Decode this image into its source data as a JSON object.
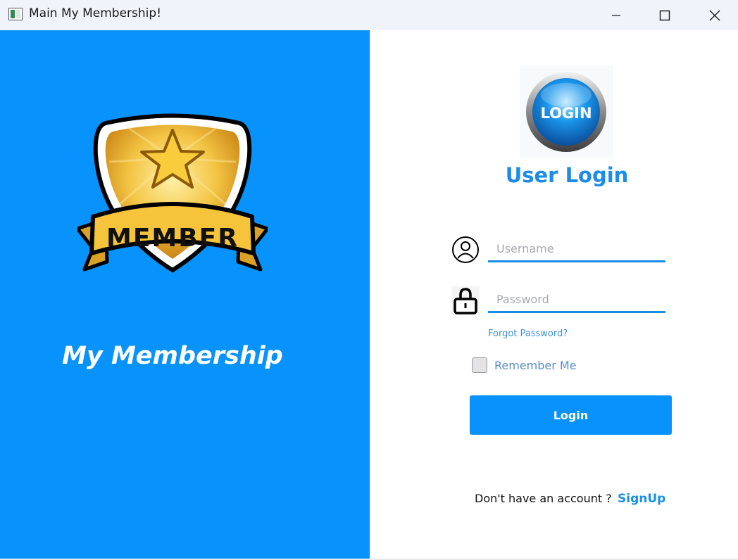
{
  "window": {
    "title": "Main My Membership!",
    "controls": {
      "minimize": "minimize-icon",
      "maximize": "maximize-icon",
      "close": "close-icon"
    }
  },
  "left_panel": {
    "badge_text": "MEMBER",
    "brand": "My Membership",
    "background": "#0892fc"
  },
  "login": {
    "logo_text": "LOGIN",
    "heading": "User Login",
    "username": {
      "value": "",
      "placeholder": "Username",
      "icon": "user-icon"
    },
    "password": {
      "value": "",
      "placeholder": "Password",
      "icon": "lock-icon"
    },
    "forgot_label": "Forgot Password?",
    "remember_label": "Remember Me",
    "remember_checked": false,
    "button_label": "Login",
    "signup_prompt": "Don't have an account ?",
    "signup_label": "SignUp"
  },
  "colors": {
    "accent": "#0892fc",
    "heading": "#1b8ce8",
    "link": "#3f8fd8"
  }
}
